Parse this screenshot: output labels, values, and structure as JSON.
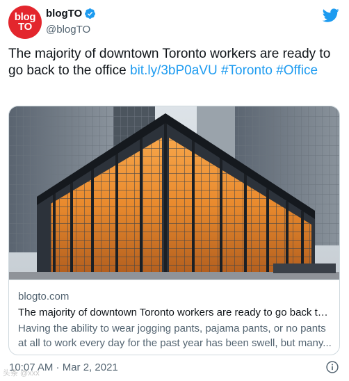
{
  "account": {
    "display_name": "blogTO",
    "handle": "@blogTO",
    "avatar_text_line1": "blog",
    "avatar_text_line2": "TO",
    "avatar_color": "#e3262d",
    "verified": true
  },
  "tweet": {
    "text": "The majority of downtown Toronto workers are ready to go back to the office ",
    "link": "bit.ly/3bP0aVU",
    "hashtags": [
      "#Toronto",
      "#Office"
    ],
    "link_color": "#1d9bf0"
  },
  "card": {
    "domain": "blogto.com",
    "title": "The majority of downtown Toronto workers are ready to go back to the office",
    "description_line1": "Having the ability to wear jogging pants, pajama pants, or no pants",
    "description_line2": "at all to work every day for the past year has been swell, but many..."
  },
  "footer": {
    "timestamp": "10:07 AM · Mar 2, 2021"
  },
  "icons": {
    "verified": "verified-badge-icon",
    "brand": "twitter-bird-icon",
    "info": "info-icon"
  },
  "watermark": "头条 @xxx"
}
